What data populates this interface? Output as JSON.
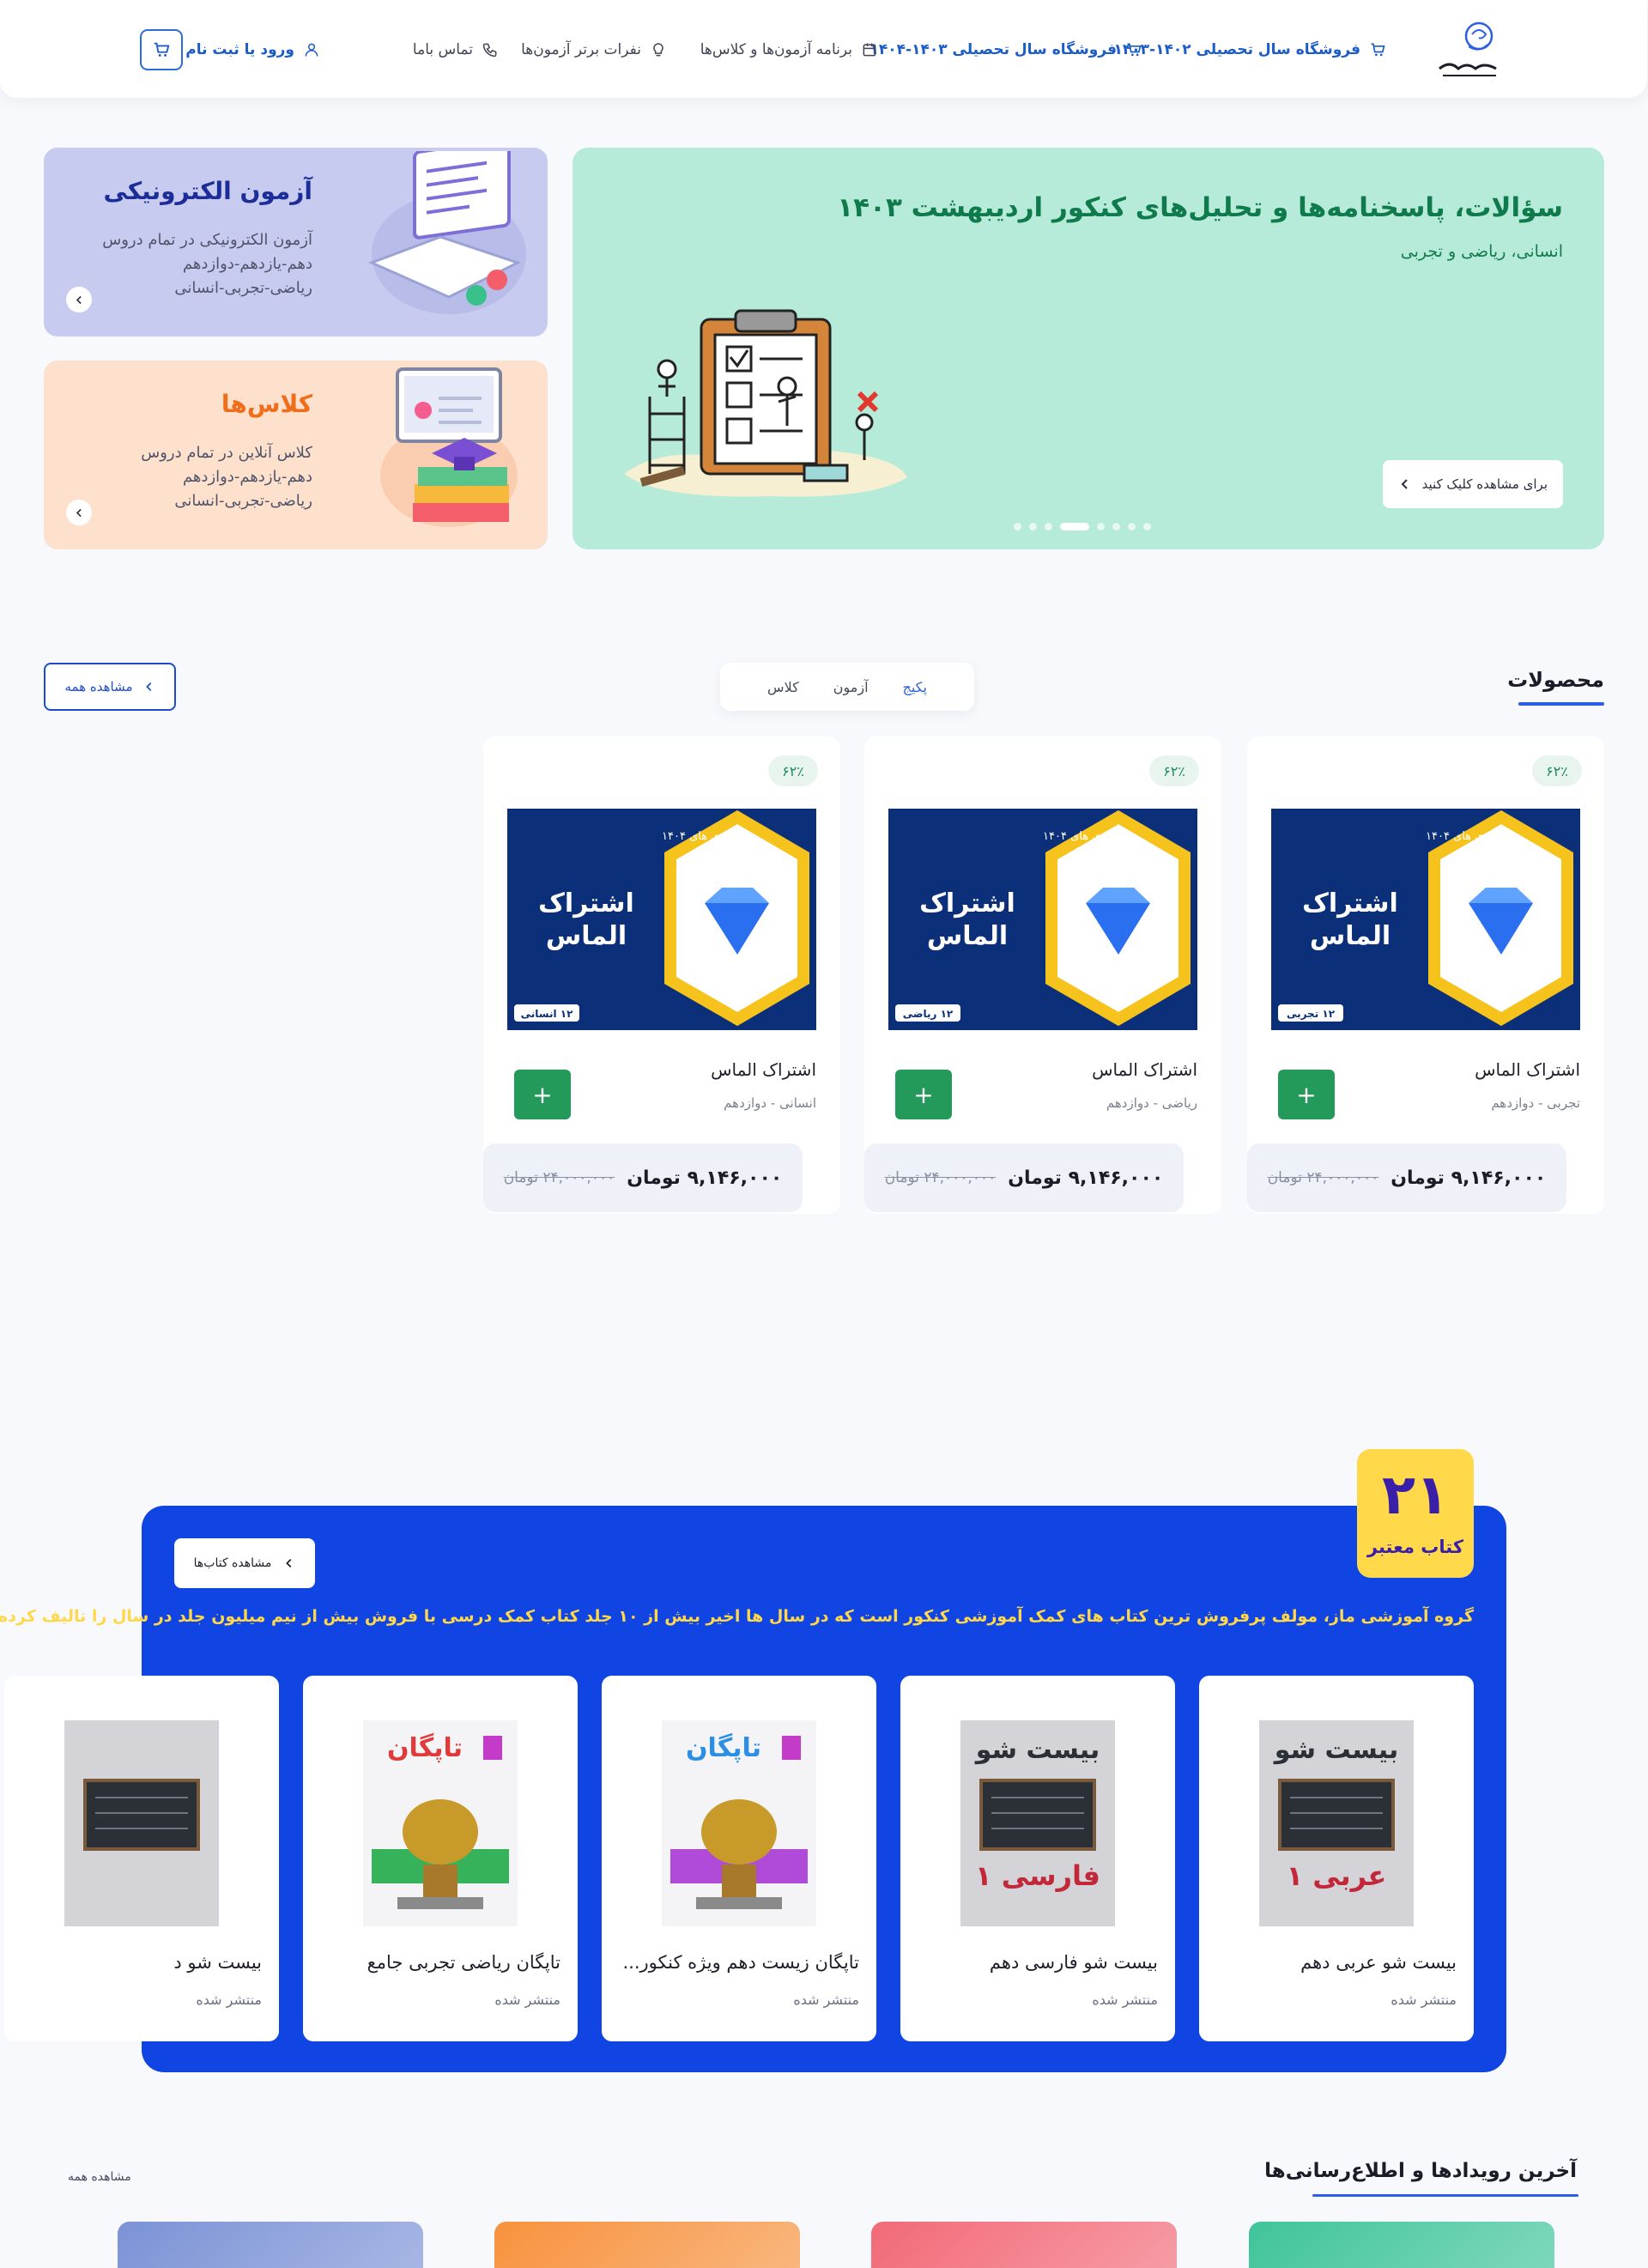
{
  "nav": {
    "store_1402": "فروشگاه سال تحصیلی ۱۴۰۲-۱۴۰۳",
    "store_1403": "فروشگاه سال تحصیلی ۱۴۰۳-۱۴۰۴",
    "schedule": "برنامه آزمون‌ها و کلاس‌ها",
    "top_ranks": "نفرات برتر آزمون‌ها",
    "contact": "تماس باما",
    "login": "ورود یا ثبت نام"
  },
  "hero": {
    "title": "سؤالات، پاسخنامه‌ها و تحلیل‌های کنکور اردیبهشت ۱۴۰۳",
    "subtitle": "انسانی، ریاضی و تجربی",
    "button": "برای مشاهده کلیک کنید",
    "slide_count": 8,
    "active_slide": 3
  },
  "side_cards": {
    "exam": {
      "title": "آزمون الکترونیکی",
      "line1": "آزمون الکترونیکی در تمام دروس",
      "line2": "دهم-یازدهم-دوازدهم",
      "line3": "ریاضی-تجربی-انسانی"
    },
    "class": {
      "title": "کلاس‌ها",
      "line1": "کلاس آنلاین در تمام دروس",
      "line2": "دهم-یازدهم-دوازدهم",
      "line3": "ریاضی-تجربی-انسانی"
    }
  },
  "products_section": {
    "title": "محصولات",
    "view_all": "مشاهده همه",
    "tabs": [
      "پکیج",
      "آزمون",
      "کلاس"
    ],
    "active_tab": 0,
    "items": [
      {
        "discount": "۶۲٪",
        "banner_top": "کنکوری های ۱۴۰۴",
        "banner_title_1": "اشتراک",
        "banner_title_2": "الماس",
        "banner_tag": "۱۲ تجربی",
        "name": "اشتراک الماس",
        "meta": "تجربی - دوازدهم",
        "price": "۹,۱۴۶,۰۰۰ تومان",
        "old_price": "۲۴,۰۰۰,۰۰۰ تومان",
        "add": "+"
      },
      {
        "discount": "۶۲٪",
        "banner_top": "کنکوری های ۱۴۰۴",
        "banner_title_1": "اشتراک",
        "banner_title_2": "الماس",
        "banner_tag": "۱۲ ریاضی",
        "name": "اشتراک الماس",
        "meta": "ریاضی - دوازدهم",
        "price": "۹,۱۴۶,۰۰۰ تومان",
        "old_price": "۲۴,۰۰۰,۰۰۰ تومان",
        "add": "+"
      },
      {
        "discount": "۶۲٪",
        "banner_top": "کنکوری های ۱۴۰۴",
        "banner_title_1": "اشتراک",
        "banner_title_2": "الماس",
        "banner_tag": "۱۲ انسانی",
        "name": "اشتراک الماس",
        "meta": "انسانی - دوازدهم",
        "price": "۹,۱۴۶,۰۰۰ تومان",
        "old_price": "۲۴,۰۰۰,۰۰۰ تومان",
        "add": "+"
      }
    ]
  },
  "books_section": {
    "count": "۲۱",
    "count_label": "کتاب معتبر",
    "button": "مشاهده کتاب‌ها",
    "description": "گروه آموزشی ماز، مولف پرفروش ترین کتاب های کمک آموزشی کنکور است که در سال ها اخیر بیش از ۱۰ جلد کتاب کمک درسی با فروش بیش از نیم میلیون جلد در سال را تالیف کرده است",
    "items": [
      {
        "name": "بیست شو عربی دهم",
        "status": "منتشر شده",
        "cover_title": "بیست شو",
        "cover_sub": "عربی ۱",
        "cover": "gray"
      },
      {
        "name": "بیست شو فارسی دهم",
        "status": "منتشر شده",
        "cover_title": "بیست شو",
        "cover_sub": "فارسی ۱",
        "cover": "gray"
      },
      {
        "name": "تاپگان زیست دهم ویژه کنکور...",
        "status": "منتشر شده",
        "cover_title": "تاپگان",
        "cover_sub": "",
        "cover": "purple"
      },
      {
        "name": "تاپگان ریاضی تجربی جامع",
        "status": "منتشر شده",
        "cover_title": "تاپگان",
        "cover_sub": "",
        "cover": "green"
      },
      {
        "name": "بیست شو د",
        "status": "منتشر شده",
        "cover_title": "",
        "cover_sub": "",
        "cover": "gray"
      }
    ]
  },
  "events_section": {
    "title": "آخرین رویدادها و اطلاع‌رسانی‌ها",
    "view_all": "مشاهده همه",
    "cards": [
      "#3fc49a",
      "#f26a78",
      "#f7923e",
      "#7b92d6"
    ]
  },
  "colors": {
    "brand_blue": "#1045e3",
    "green": "#23995a",
    "hero_bg": "#b6ead9"
  }
}
